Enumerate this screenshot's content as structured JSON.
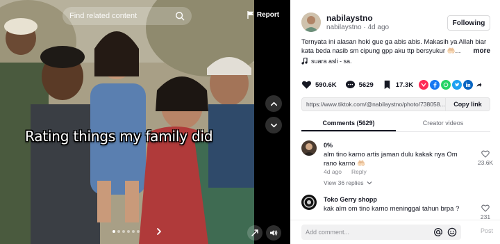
{
  "media": {
    "search_placeholder": "Find related content",
    "report_label": "Report",
    "caption": "Rating things my family did",
    "slide_dots": 6,
    "active_dot": 0
  },
  "post": {
    "author_name": "nabilaystno",
    "author_handle": "nabilaystno",
    "posted": "4d ago",
    "follow_label": "Following",
    "description": "Ternyata ini alasan hoki gue ga abis abis. Makasih ya Allah biar kata beda nasib sm cipung gpp aku ttp bersyukur 🤲🏻...",
    "more_label": "more",
    "sound": "suara asli - sa.",
    "likes": "590.6K",
    "comments_count": "5629",
    "saves": "17.3K",
    "link": "https://www.tiktok.com/@nabilaystno/photo/738058...",
    "copy_label": "Copy link"
  },
  "tabs": {
    "comments": "Comments (5629)",
    "creator_videos": "Creator videos"
  },
  "comments": [
    {
      "name": "0%",
      "text": "alm tino karno artis jaman dulu kakak nya Om rano karno 🤲🏻",
      "time": "4d ago",
      "reply": "Reply",
      "view_replies": "View 36 replies",
      "likes": "23.6K"
    },
    {
      "name": "Toko Gerry shopp",
      "text": "kak alm om tino karno meninggal tahun brpa ?",
      "likes": "231"
    }
  ],
  "add_comment": {
    "placeholder": "Add comment...",
    "post_label": "Post"
  },
  "colors": {
    "accent": "#fe2c55",
    "text": "#161823",
    "muted": "#8a8b91"
  },
  "icons": {
    "search": "search-icon",
    "report": "flag-icon",
    "up": "chevron-up-icon",
    "down": "chevron-down-icon",
    "heart": "heart-icon",
    "comment": "comment-icon",
    "bookmark": "bookmark-icon",
    "share_targets": [
      "embed-icon",
      "facebook-icon",
      "whatsapp-icon",
      "twitter-icon",
      "linkedin-icon",
      "share-arrow-icon"
    ]
  }
}
